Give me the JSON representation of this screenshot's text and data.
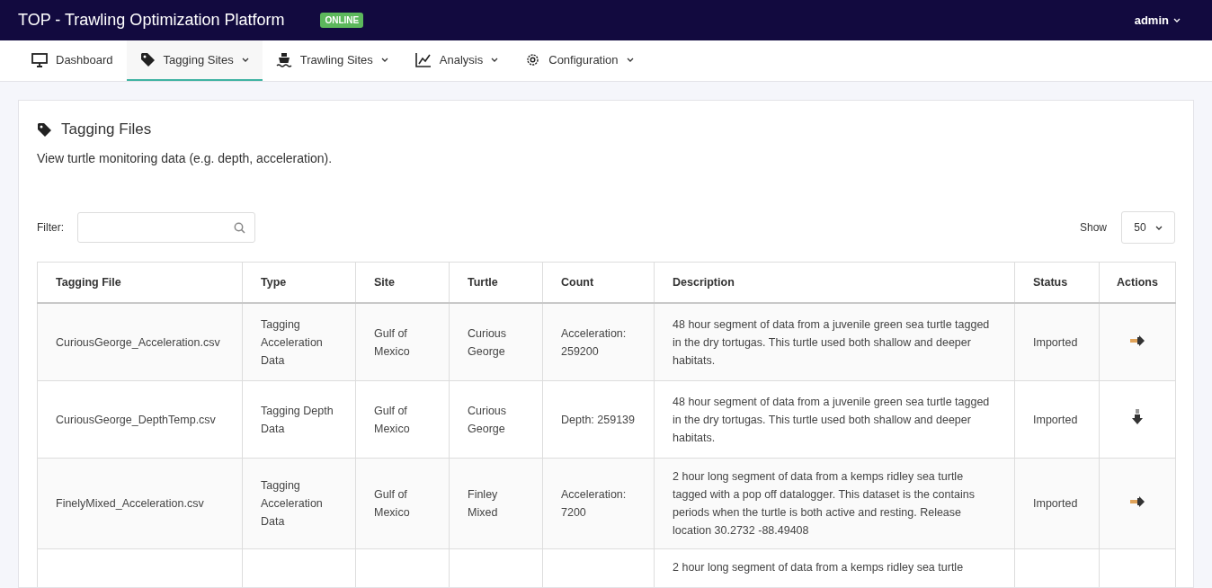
{
  "app": {
    "title": "TOP - Trawling Optimization Platform",
    "status_badge": "ONLINE",
    "user": "admin"
  },
  "nav": [
    {
      "label": "Dashboard",
      "dropdown": false,
      "selected": false
    },
    {
      "label": "Tagging Sites",
      "dropdown": true,
      "selected": true
    },
    {
      "label": "Trawling Sites",
      "dropdown": true,
      "selected": false
    },
    {
      "label": "Analysis",
      "dropdown": true,
      "selected": false
    },
    {
      "label": "Configuration",
      "dropdown": true,
      "selected": false
    }
  ],
  "card": {
    "title": "Tagging Files",
    "subtitle": "View turtle monitoring data (e.g. depth, acceleration).",
    "filter_label": "Filter:",
    "show_label": "Show",
    "page_size": "50"
  },
  "table": {
    "columns": [
      "Tagging File",
      "Type",
      "Site",
      "Turtle",
      "Count",
      "Description",
      "Status",
      "Actions"
    ],
    "rows": [
      {
        "file": "CuriousGeorge_Acceleration.csv",
        "type": "Tagging Acceleration Data",
        "site": "Gulf of Mexico",
        "turtle": "Curious George",
        "count": "Acceleration: 259200",
        "description": "48 hour segment of data from a juvenile green sea turtle tagged in the dry tortugas. This turtle used both shallow and deeper habitats.",
        "status": "Imported",
        "kind": "arrow-right"
      },
      {
        "file": "CuriousGeorge_DepthTemp.csv",
        "type": "Tagging Depth Data",
        "site": "Gulf of Mexico",
        "turtle": "Curious George",
        "count": "Depth: 259139",
        "description": "48 hour segment of data from a juvenile green sea turtle tagged in the dry tortugas. This turtle used both shallow and deeper habitats.",
        "status": "Imported",
        "kind": "arrow-down"
      },
      {
        "file": "FinelyMixed_Acceleration.csv",
        "type": "Tagging Acceleration Data",
        "site": "Gulf of Mexico",
        "turtle": "Finley Mixed",
        "count": "Acceleration: 7200",
        "description": "2 hour long segment of data from a kemps ridley sea turtle tagged with a pop off datalogger. This dataset is the contains periods when the turtle is both active and resting. Release location 30.2732 -88.49408",
        "status": "Imported",
        "kind": "arrow-right"
      },
      {
        "description": "2 hour long segment of data from a kemps ridley sea turtle"
      }
    ]
  }
}
